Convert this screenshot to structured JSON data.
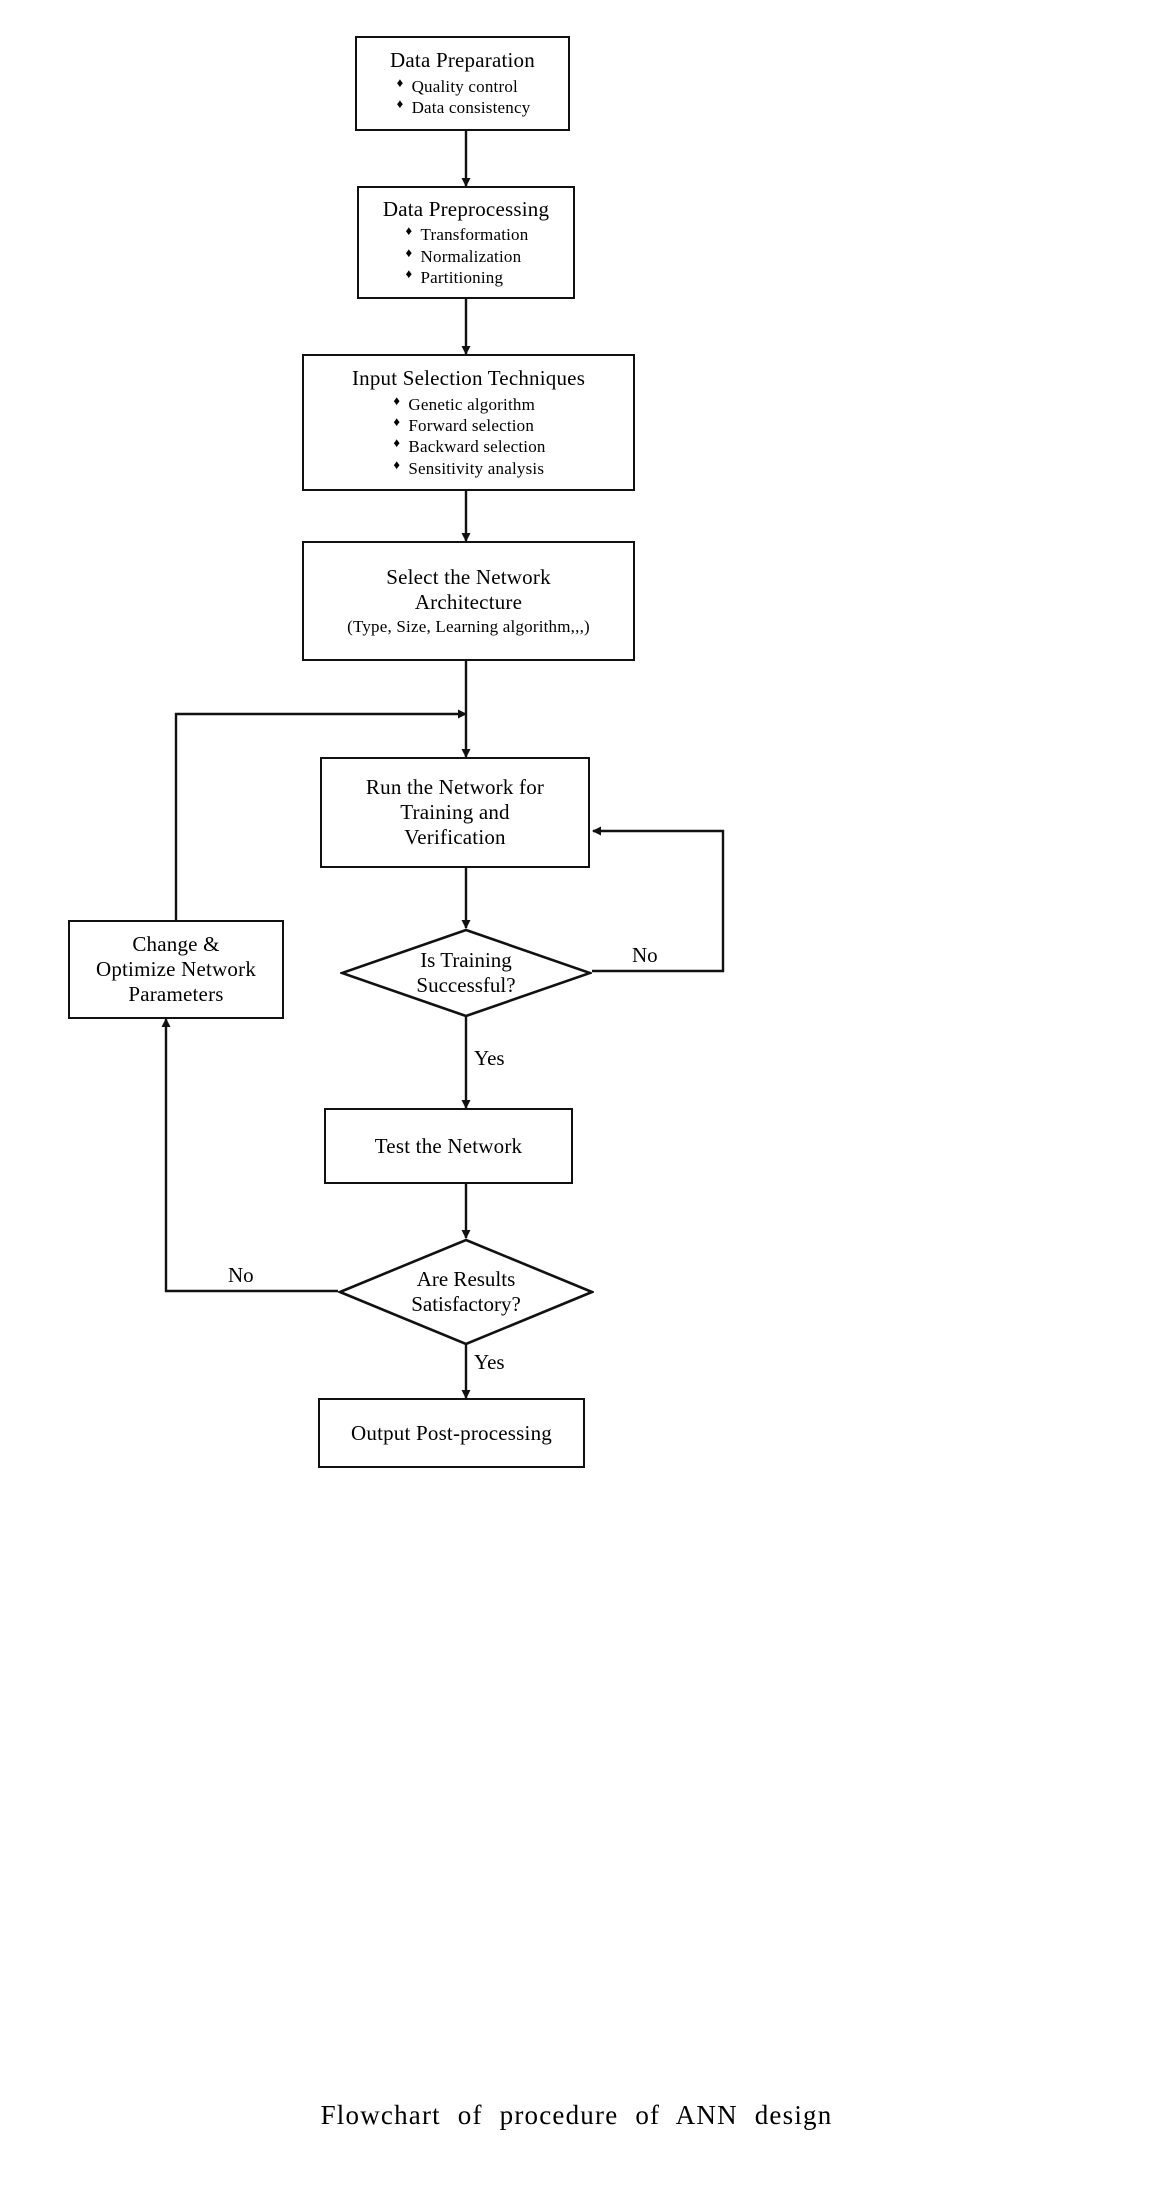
{
  "figure": {
    "caption": "Flowchart  of  procedure  of  ANN  design",
    "ink_color": "#111111",
    "background_color": "#ffffff"
  },
  "nodes": {
    "data_preparation": {
      "title": "Data Preparation",
      "bullets": [
        "Quality control",
        "Data consistency"
      ]
    },
    "data_preprocessing": {
      "title": "Data Preprocessing",
      "bullets": [
        "Transformation",
        "Normalization",
        "Partitioning"
      ]
    },
    "input_selection": {
      "title": "Input Selection Techniques",
      "bullets": [
        "Genetic algorithm",
        "Forward selection",
        "Backward selection",
        "Sensitivity analysis"
      ]
    },
    "select_architecture": {
      "title": "Select the Network\nArchitecture",
      "subtitle": "(Type, Size, Learning algorithm,,,)"
    },
    "run_network": {
      "title": "Run the Network for\nTraining and\nVerification"
    },
    "change_optimize": {
      "title": "Change &\nOptimize Network\nParameters"
    },
    "test_network": {
      "title": "Test the Network"
    },
    "output_postprocessing": {
      "title": "Output Post-processing"
    }
  },
  "decisions": {
    "is_training_successful": {
      "label": "Is Training\nSuccessful?"
    },
    "are_results_satisfactory": {
      "label": "Are Results\nSatisfactory?"
    }
  },
  "edge_labels": {
    "training_no": "No",
    "training_yes": "Yes",
    "results_no": "No",
    "results_yes": "Yes"
  }
}
